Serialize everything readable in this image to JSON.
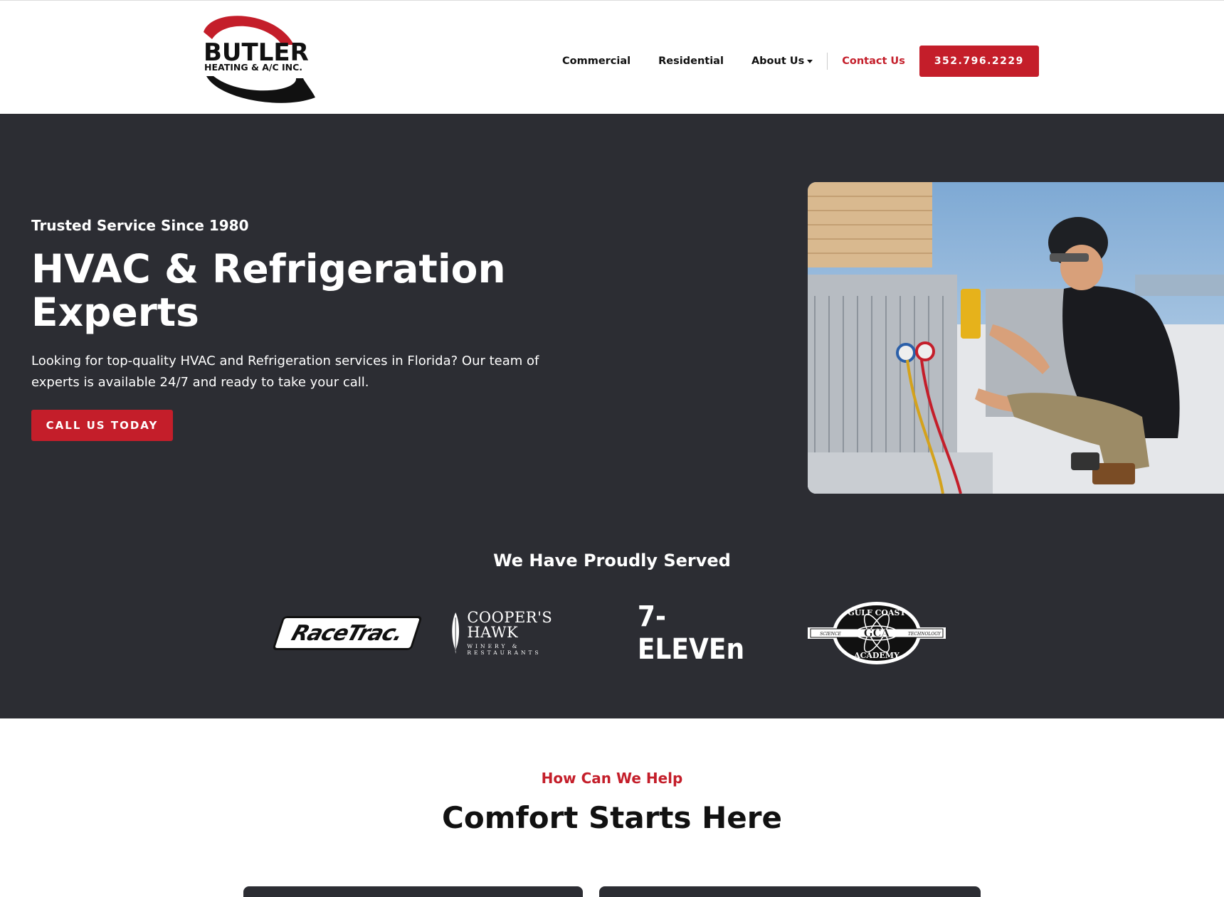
{
  "header": {
    "logo": {
      "name": "BUTLER",
      "tagline": "HEATING & A/C INC.",
      "accent_color": "#c41e2a"
    },
    "nav": {
      "commercial": "Commercial",
      "residential": "Residential",
      "about": "About Us",
      "contact": "Contact Us"
    },
    "phone": "352.796.2229"
  },
  "hero": {
    "eyebrow": "Trusted Service Since 1980",
    "title": "HVAC & Refrigeration Experts",
    "description": "Looking for top-quality HVAC and Refrigeration services in Florida? Our team of experts is available 24/7 and ready to take your call.",
    "cta": "CALL US TODAY",
    "background_color": "#2c2d33"
  },
  "served": {
    "title": "We Have Proudly Served",
    "clients": {
      "racetrac": "RaceTrac.",
      "coopers_hawk_name": "COOPER'S HAWK",
      "coopers_hawk_sub": "WINERY & RESTAURANTS",
      "seven_eleven": "7-ELEVEn",
      "gca_top": "GULF COAST",
      "gca_center": "GCA",
      "gca_bottom": "ACADEMY",
      "gca_left": "SCIENCE",
      "gca_right": "TECHNOLOGY"
    }
  },
  "help": {
    "eyebrow": "How Can We Help",
    "title": "Comfort Starts Here"
  },
  "colors": {
    "brand_red": "#c41e2a",
    "dark": "#2c2d33"
  }
}
